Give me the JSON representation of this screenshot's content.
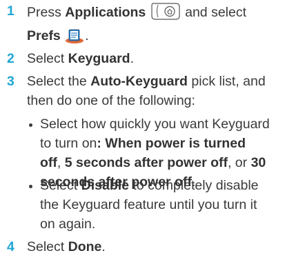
{
  "accent_color": "#1fa6d4",
  "steps": [
    {
      "number": "1",
      "t1": "Press ",
      "b1": "Applications",
      "t2": " and select",
      "b2": "Prefs",
      "t3": ".",
      "icons": [
        "applications-key-icon",
        "prefs-app-icon"
      ]
    },
    {
      "number": "2",
      "t1": "Select ",
      "b1": "Keyguard",
      "t2": "."
    },
    {
      "number": "3",
      "t1": "Select the ",
      "b1": "Auto-Keyguard",
      "t2": " pick list, and",
      "t3": "then do one of the following:",
      "bullets": [
        {
          "l1_t1": "Select how quickly you want Keyguard",
          "l2_t1": "to turn on",
          "l2_b1": ": When power is turned",
          "l3_b1": "off",
          "l3_t1": ", ",
          "l3_b2": "5 seconds after power off",
          "l3_t2": ", or ",
          "l3_b3": "30",
          "l4_b1": "seconds after power off",
          "l4_t1": "."
        },
        {
          "l1_t1": "Select ",
          "l1_b1": "Disable",
          "l1_t2": " to completely disable",
          "l2_t1": "the Keyguard feature until you turn it",
          "l3_t1": "on again."
        }
      ]
    },
    {
      "number": "4",
      "t1": "Select ",
      "b1": "Done",
      "t2": "."
    }
  ]
}
